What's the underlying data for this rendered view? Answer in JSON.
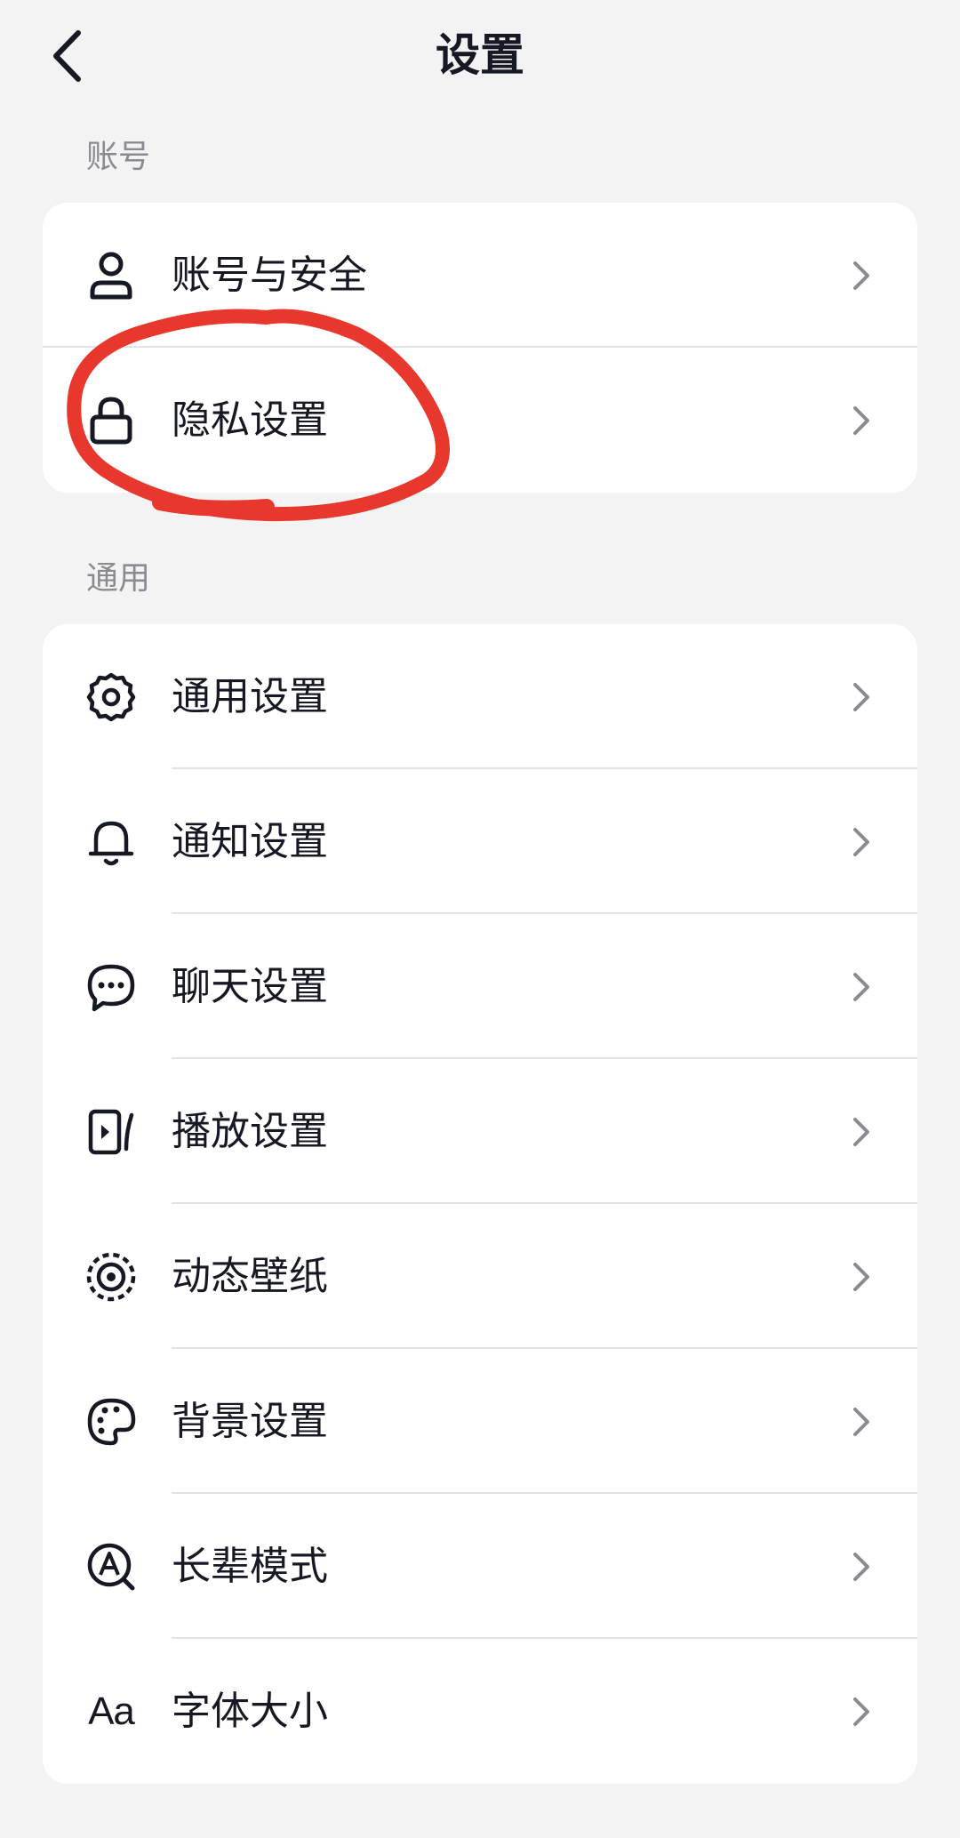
{
  "header": {
    "title": "设置"
  },
  "sections": {
    "account": {
      "label": "账号",
      "items": [
        {
          "label": "账号与安全",
          "icon": "user-icon"
        },
        {
          "label": "隐私设置",
          "icon": "lock-icon"
        }
      ]
    },
    "general": {
      "label": "通用",
      "items": [
        {
          "label": "通用设置",
          "icon": "gear-icon"
        },
        {
          "label": "通知设置",
          "icon": "bell-icon"
        },
        {
          "label": "聊天设置",
          "icon": "chat-bubble-icon"
        },
        {
          "label": "播放设置",
          "icon": "play-screen-icon"
        },
        {
          "label": "动态壁纸",
          "icon": "live-wallpaper-icon"
        },
        {
          "label": "背景设置",
          "icon": "palette-icon"
        },
        {
          "label": "长辈模式",
          "icon": "elder-mode-icon"
        },
        {
          "label": "字体大小",
          "icon": "font-size-icon",
          "icon_text": "Aa"
        }
      ]
    }
  },
  "colors": {
    "background": "#f3f3f4",
    "card": "#ffffff",
    "text": "#161823",
    "secondary_text": "#8a8b91",
    "chevron": "#8a8b91",
    "annotation": "#e8372c"
  }
}
